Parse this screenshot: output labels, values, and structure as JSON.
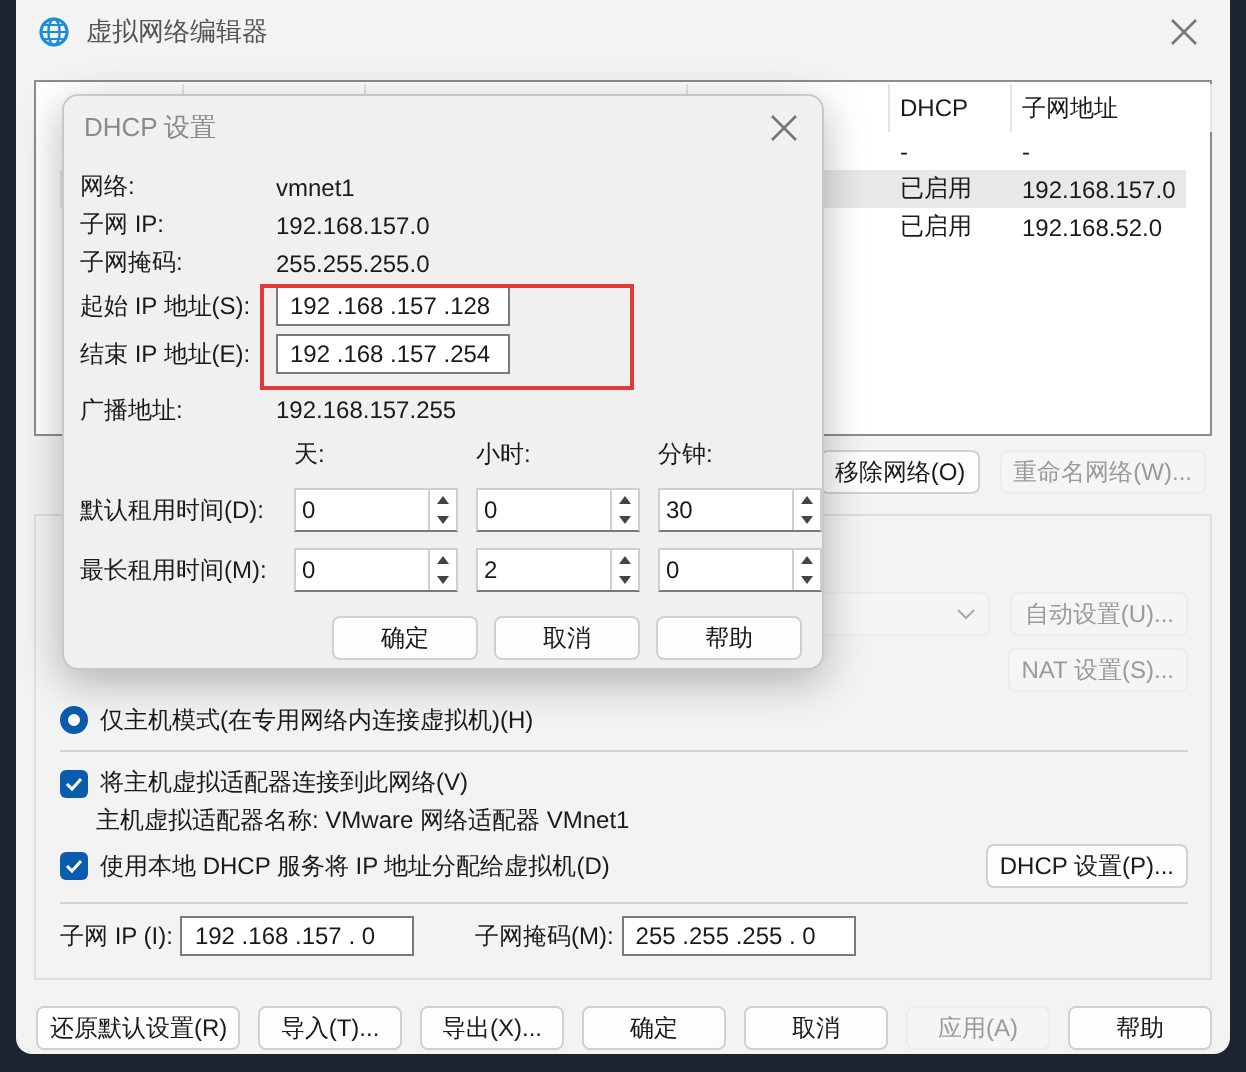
{
  "main_window": {
    "title": "虚拟网络编辑器"
  },
  "network_table": {
    "columns": [
      {
        "label": "DHCP"
      },
      {
        "label": "子网地址"
      }
    ],
    "rows": [
      {
        "dhcp": "-",
        "subnet": "-",
        "selected": false
      },
      {
        "dhcp": "已启用",
        "subnet": "192.168.157.0",
        "selected": true
      },
      {
        "dhcp": "已启用",
        "subnet": "192.168.52.0",
        "selected": false
      }
    ]
  },
  "network_buttons": [
    {
      "label": "移除网络(O)",
      "disabled": false
    },
    {
      "label": "重命名网络(W)...",
      "disabled": true
    }
  ],
  "bridge_dropdown": {
    "disabled": true
  },
  "side_buttons": [
    {
      "label": "自动设置(U)...",
      "disabled": true
    },
    {
      "label": "NAT 设置(S)...",
      "disabled": true
    }
  ],
  "host_only_radio": {
    "label": "仅主机模式(在专用网络内连接虚拟机)(H)",
    "selected": true
  },
  "connect_adapter": {
    "label": "将主机虚拟适配器连接到此网络(V)",
    "checked": true
  },
  "adapter_name": "主机虚拟适配器名称: VMware 网络适配器 VMnet1",
  "use_dhcp": {
    "label": "使用本地 DHCP 服务将 IP 地址分配给虚拟机(D)",
    "checked": true
  },
  "dhcp_settings_button": "DHCP 设置(P)...",
  "subnet_fields": [
    {
      "label": "子网 IP (I):",
      "value": "192 .168 .157 . 0"
    },
    {
      "label": "子网掩码(M):",
      "value": "255 .255 .255 . 0"
    }
  ],
  "footer_buttons": [
    {
      "label": "还原默认设置(R)",
      "disabled": false
    },
    {
      "label": "导入(T)...",
      "disabled": false
    },
    {
      "label": "导出(X)...",
      "disabled": false
    },
    {
      "label": "确定",
      "disabled": false
    },
    {
      "label": "取消",
      "disabled": false
    },
    {
      "label": "应用(A)",
      "disabled": true
    },
    {
      "label": "帮助",
      "disabled": false
    }
  ],
  "dhcp_dialog": {
    "title": "DHCP 设置",
    "info": [
      {
        "kind": "text",
        "label": "网络:",
        "value": "vmnet1"
      },
      {
        "kind": "text",
        "label": "子网 IP:",
        "value": "192.168.157.0"
      },
      {
        "kind": "text",
        "label": "子网掩码:",
        "value": "255.255.255.0"
      },
      {
        "kind": "field",
        "label": "起始 IP 地址(S):",
        "value": "192 .168 .157 .128"
      },
      {
        "kind": "field",
        "label": "结束 IP 地址(E):",
        "value": "192 .168 .157 .254"
      },
      {
        "kind": "text",
        "label": "广播地址:",
        "value": "192.168.157.255"
      }
    ],
    "highlight_box": true,
    "lease_headers": [
      "天:",
      "小时:",
      "分钟:"
    ],
    "leases": [
      {
        "label": "默认租用时间(D):",
        "values": [
          "0",
          "0",
          "30"
        ]
      },
      {
        "label": "最长租用时间(M):",
        "values": [
          "0",
          "2",
          "0"
        ]
      }
    ],
    "buttons": [
      "确定",
      "取消",
      "帮助"
    ]
  }
}
